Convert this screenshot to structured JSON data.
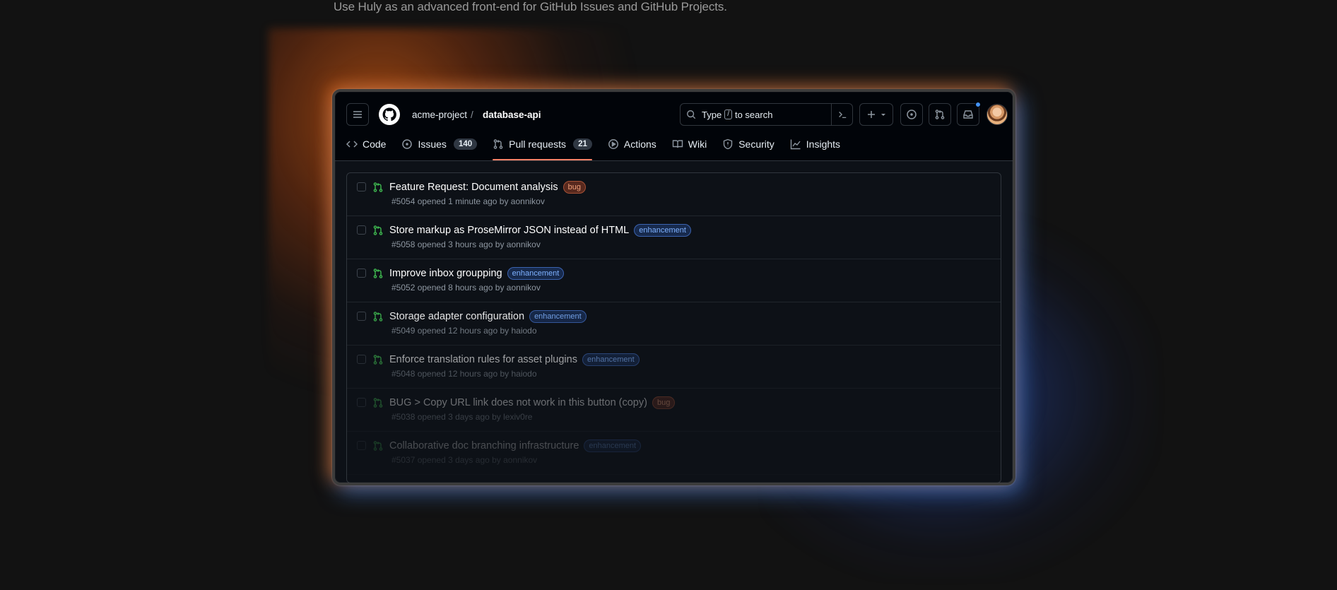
{
  "page": {
    "subtitle": "Use Huly as an advanced front-end for GitHub Issues and GitHub Projects."
  },
  "header": {
    "owner": "acme-project",
    "separator": "/",
    "repo": "database-api",
    "search_prefix": "Type",
    "search_key": "/",
    "search_suffix": "to search"
  },
  "tabs": [
    {
      "label": "Code",
      "icon": "code-icon"
    },
    {
      "label": "Issues",
      "count": "140",
      "icon": "issue-opened-icon"
    },
    {
      "label": "Pull requests",
      "count": "21",
      "icon": "git-pull-request-icon",
      "active": true
    },
    {
      "label": "Actions",
      "icon": "play-icon"
    },
    {
      "label": "Wiki",
      "icon": "book-icon"
    },
    {
      "label": "Security",
      "icon": "shield-icon"
    },
    {
      "label": "Insights",
      "icon": "graph-icon"
    }
  ],
  "pull_requests": [
    {
      "title": "Feature Request: Document analysis",
      "label": "bug",
      "meta": "#5054 opened 1 minute ago by aonnikov"
    },
    {
      "title": "Store markup as ProseMirror JSON instead of HTML",
      "label": "enhancement",
      "meta": "#5058 opened 3 hours ago by aonnikov"
    },
    {
      "title": "Improve inbox groupping",
      "label": "enhancement",
      "meta": "#5052 opened 8 hours ago by aonnikov"
    },
    {
      "title": "Storage adapter configuration",
      "label": "enhancement",
      "meta": "#5049 opened 12 hours ago by haiodo"
    },
    {
      "title": "Enforce translation rules for asset plugins",
      "label": "enhancement",
      "meta": "#5048 opened 12 hours ago by haiodo"
    },
    {
      "title": "BUG > Copy URL link does not work in this button (copy)",
      "label": "bug",
      "meta": "#5038 opened 3 days ago by lexiv0re"
    },
    {
      "title": "Collaborative doc branching infrastructure",
      "label": "enhancement",
      "meta": "#5037 opened 3 days ago by aonnikov"
    }
  ],
  "colors": {
    "background": "#121212",
    "window": "#0d1117",
    "accent_orange": "#f78166",
    "pr_open_green": "#3fb950",
    "notification_blue": "#4493f8"
  }
}
